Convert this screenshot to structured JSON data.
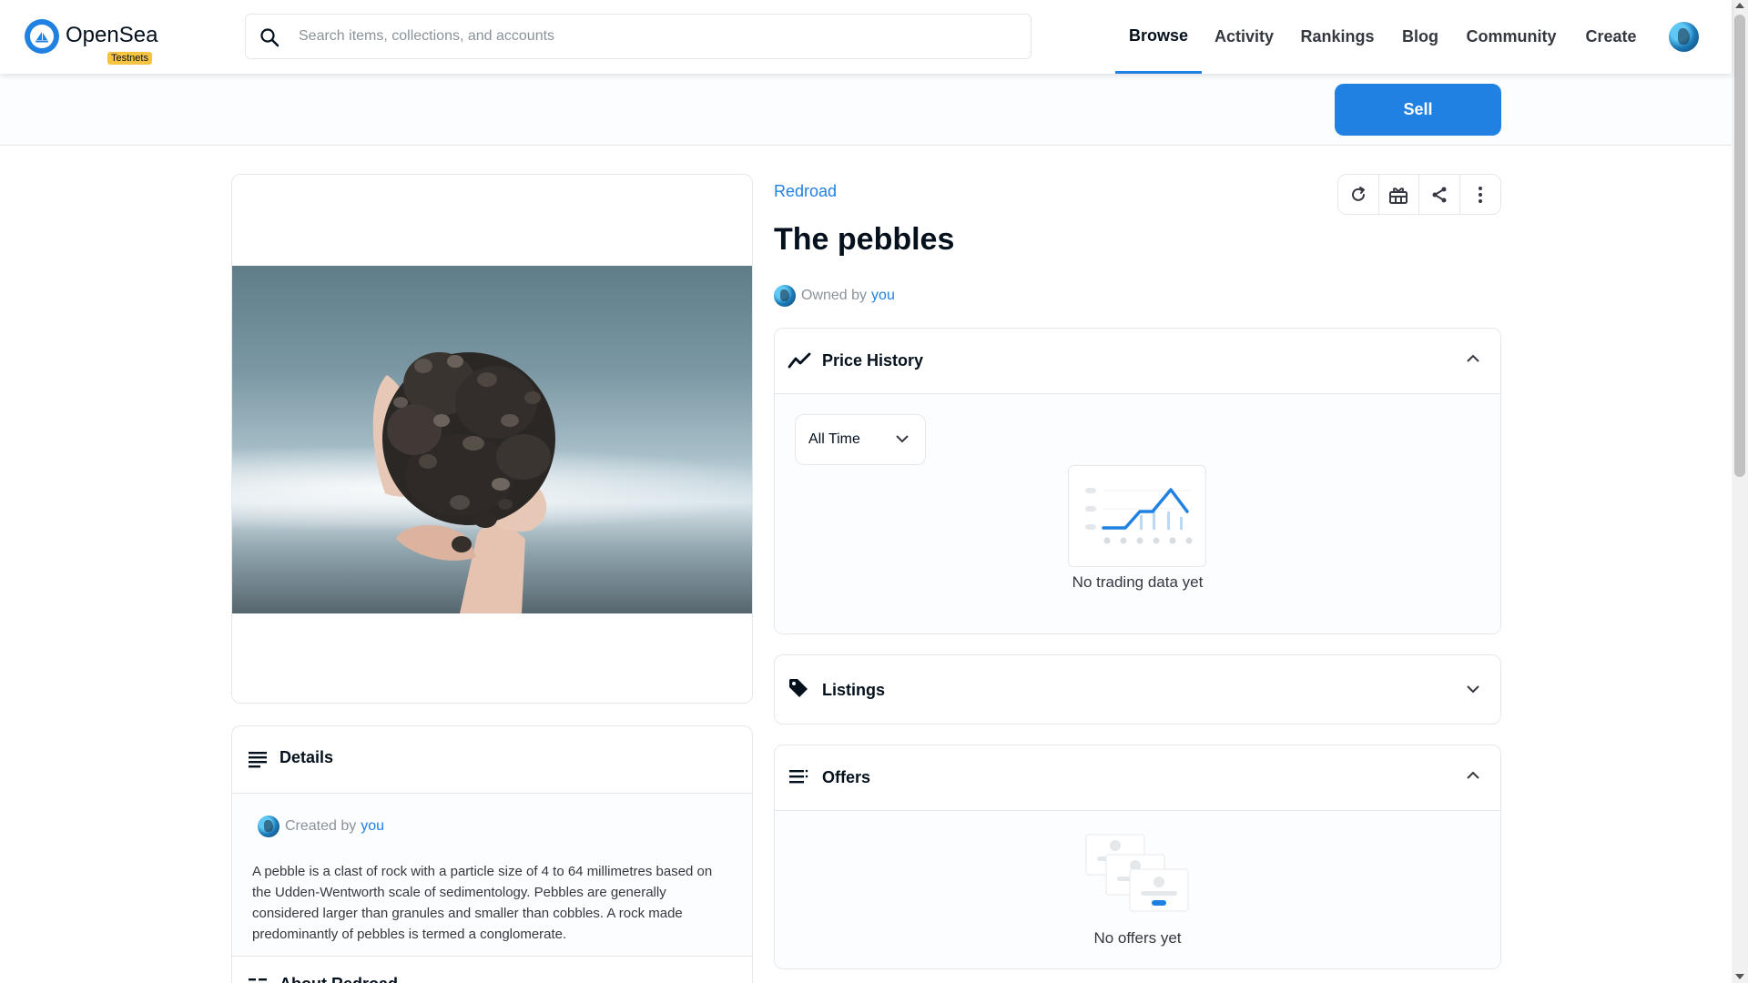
{
  "header": {
    "brand": "OpenSea",
    "badge": "Testnets",
    "search_placeholder": "Search items, collections, and accounts",
    "nav": [
      {
        "label": "Browse",
        "active": true
      },
      {
        "label": "Activity"
      },
      {
        "label": "Rankings"
      },
      {
        "label": "Blog"
      },
      {
        "label": "Community"
      },
      {
        "label": "Create"
      }
    ]
  },
  "sellbar": {
    "sell_label": "Sell"
  },
  "item": {
    "collection": "Redroad",
    "title": "The pebbles",
    "owned_prefix": "Owned by",
    "owner": "you"
  },
  "details": {
    "title": "Details",
    "created_prefix": "Created by",
    "creator": "you",
    "description": "A pebble is a clast of rock with a particle size of 4 to 64 millimetres based on the Udden-Wentworth scale of sedimentology. Pebbles are generally considered larger than granules and smaller than cobbles. A rock made predominantly of pebbles is termed a conglomerate.",
    "about_label": "About Redroad"
  },
  "price_history": {
    "title": "Price History",
    "range": "All Time",
    "empty": "No trading data yet"
  },
  "listings": {
    "title": "Listings"
  },
  "offers": {
    "title": "Offers",
    "empty": "No offers yet"
  },
  "colors": {
    "accent": "#2081e2",
    "badge": "#f6c343",
    "text": "#04111d"
  }
}
